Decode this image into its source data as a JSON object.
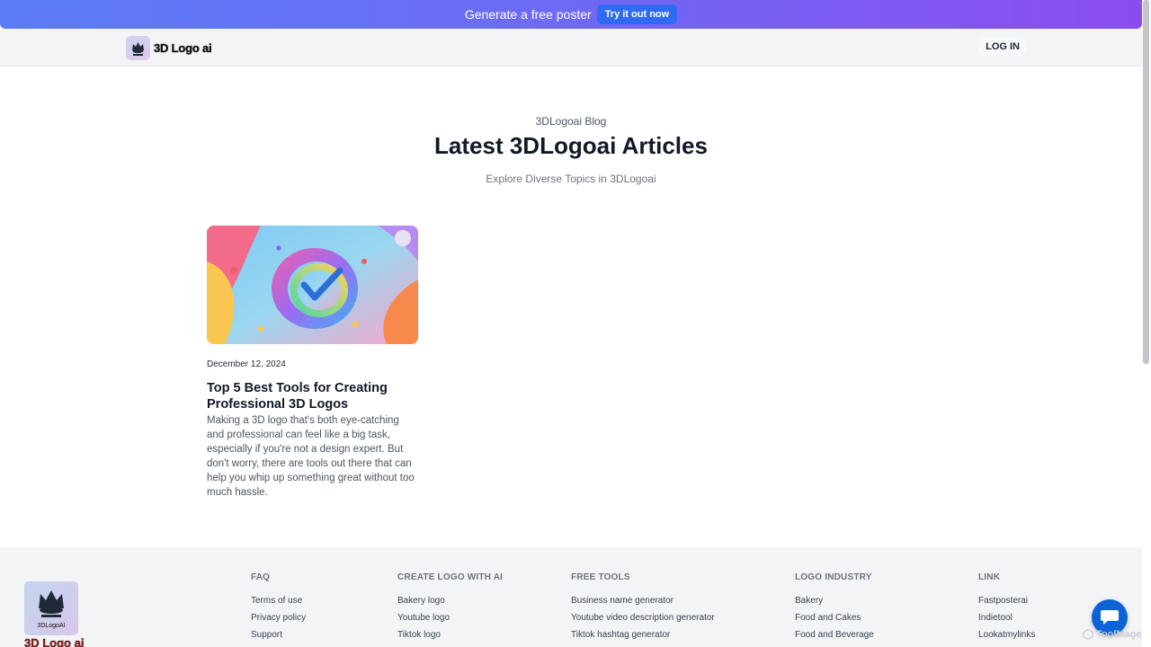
{
  "promo": {
    "text": "Generate a free poster",
    "cta": "Try it out now"
  },
  "nav": {
    "brand_name": "3D Logo ai",
    "login": "LOG IN"
  },
  "hero": {
    "kicker": "3DLogoai Blog",
    "title": "Latest 3DLogoai Articles",
    "subtitle": "Explore Diverse Topics in 3DLogoai"
  },
  "article": {
    "date": "December 12, 2024",
    "title": "Top 5 Best Tools for Creating Professional 3D Logos",
    "excerpt": "Making a 3D logo that's both eye-catching and professional can feel like a big task, especially if you're not a design expert. But don't worry, there are tools out there that can help you whip up something great without too much hassle."
  },
  "footer": {
    "logo_text": "3DLogoAI",
    "brand_name": "3D Logo ai",
    "columns": [
      {
        "heading": "FAQ",
        "links": [
          "Terms of use",
          "Privacy policy",
          "Support"
        ]
      },
      {
        "heading": "CREATE LOGO WITH AI",
        "links": [
          "Bakery logo",
          "Youtube logo",
          "Tiktok logo"
        ]
      },
      {
        "heading": "FREE TOOLS",
        "links": [
          "Business name generator",
          "Youtube video description generator",
          "Tiktok hashtag generator"
        ]
      },
      {
        "heading": "LOGO INDUSTRY",
        "links": [
          "Bakery",
          "Food and Cakes",
          "Food and Beverage"
        ]
      },
      {
        "heading": "LINK",
        "links": [
          "Fastposterai",
          "Indietool",
          "Lookatmylinks"
        ]
      }
    ]
  },
  "watermark": "ToolMage",
  "icons": {
    "chat": "chat-icon",
    "brand": "crown-logo-icon"
  },
  "colors": {
    "promo_start": "#5b7cf5",
    "promo_end": "#8b4cf0",
    "cta": "#2f6bf2",
    "chat": "#0b63d6"
  }
}
